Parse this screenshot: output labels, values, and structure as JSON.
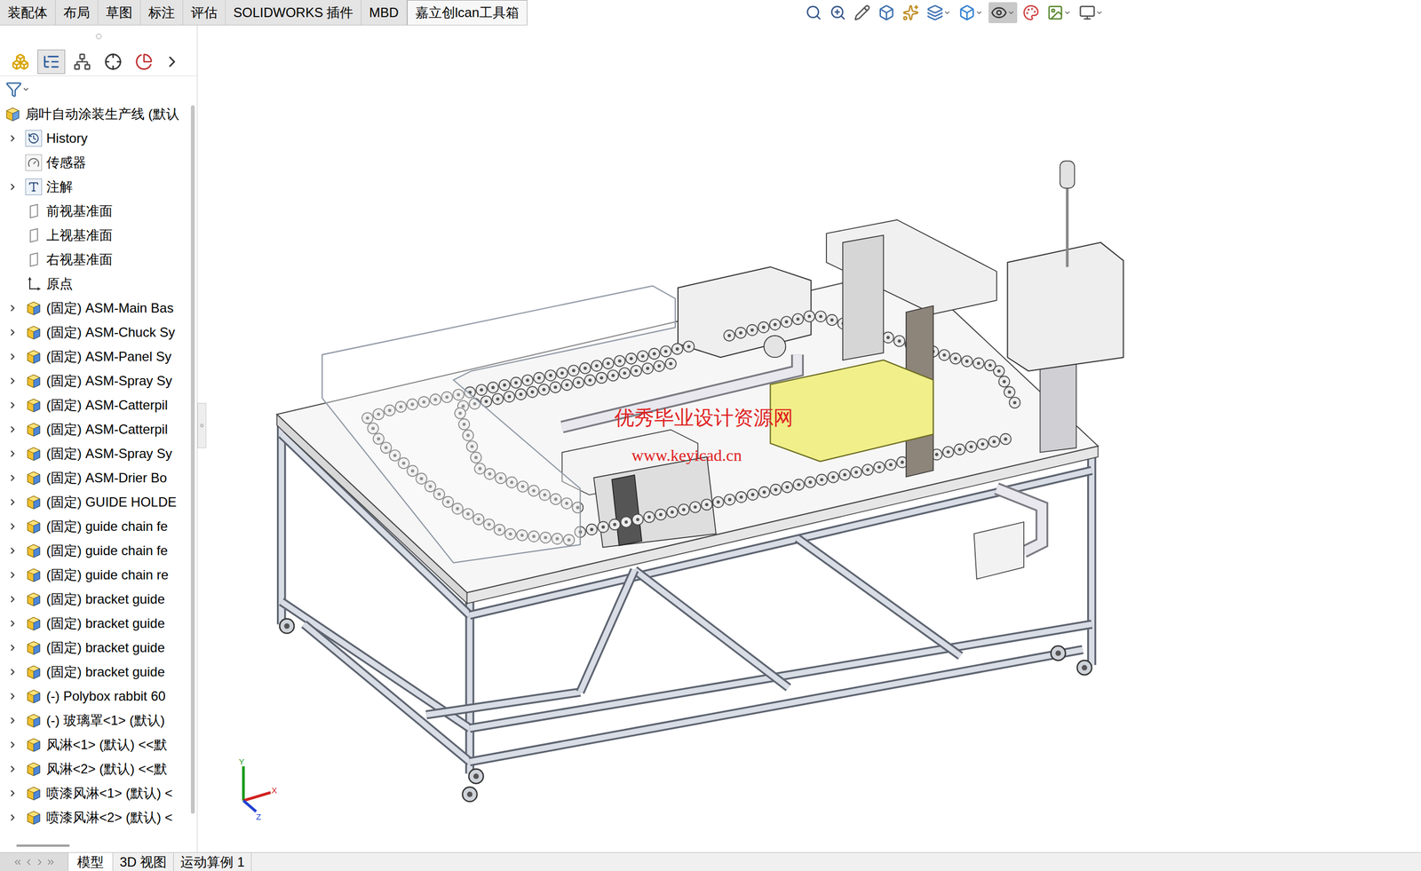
{
  "tabs": [
    {
      "label": "装配体",
      "selected": false
    },
    {
      "label": "布局",
      "selected": false
    },
    {
      "label": "草图",
      "selected": false
    },
    {
      "label": "标注",
      "selected": false
    },
    {
      "label": "评估",
      "selected": false
    },
    {
      "label": "SOLIDWORKS 插件",
      "selected": false
    },
    {
      "label": "MBD",
      "selected": false
    },
    {
      "label": "嘉立创lcan工具箱",
      "selected": true
    }
  ],
  "toolbar": [
    {
      "selected": false,
      "dropdown": false
    },
    {
      "selected": false,
      "dropdown": false
    },
    {
      "selected": false,
      "dropdown": false
    },
    {
      "selected": false,
      "dropdown": false
    },
    {
      "selected": false,
      "dropdown": false
    },
    {
      "selected": false,
      "dropdown": true
    },
    {
      "selected": false,
      "dropdown": true
    },
    {
      "selected": true,
      "dropdown": true
    },
    {
      "selected": false,
      "dropdown": false
    },
    {
      "selected": false,
      "dropdown": true
    },
    {
      "selected": false,
      "dropdown": true
    }
  ],
  "panel_tabs": [
    {
      "selected": false
    },
    {
      "selected": true
    },
    {
      "selected": false
    },
    {
      "selected": false
    },
    {
      "selected": false
    }
  ],
  "tree": [
    {
      "label": "扇叶自动涂装生产线 (默认",
      "kind": "root",
      "depth": 0,
      "expandable": false
    },
    {
      "label": "History",
      "kind": "history",
      "depth": 1,
      "expandable": true
    },
    {
      "label": "传感器",
      "kind": "sensor",
      "depth": 1,
      "expandable": false
    },
    {
      "label": "注解",
      "kind": "annotation",
      "depth": 1,
      "expandable": true
    },
    {
      "label": "前视基准面",
      "kind": "plane",
      "depth": 1,
      "expandable": false
    },
    {
      "label": "上视基准面",
      "kind": "plane",
      "depth": 1,
      "expandable": false
    },
    {
      "label": "右视基准面",
      "kind": "plane",
      "depth": 1,
      "expandable": false
    },
    {
      "label": "原点",
      "kind": "origin",
      "depth": 1,
      "expandable": false
    },
    {
      "label": "(固定) ASM-Main Bas",
      "kind": "assembly",
      "depth": 1,
      "expandable": true
    },
    {
      "label": "(固定) ASM-Chuck Sy",
      "kind": "assembly",
      "depth": 1,
      "expandable": true
    },
    {
      "label": "(固定) ASM-Panel Sy",
      "kind": "assembly",
      "depth": 1,
      "expandable": true
    },
    {
      "label": "(固定) ASM-Spray Sy",
      "kind": "assembly",
      "depth": 1,
      "expandable": true
    },
    {
      "label": "(固定) ASM-Catterpil",
      "kind": "assembly",
      "depth": 1,
      "expandable": true
    },
    {
      "label": "(固定) ASM-Catterpil",
      "kind": "assembly",
      "depth": 1,
      "expandable": true
    },
    {
      "label": "(固定) ASM-Spray Sy",
      "kind": "assembly",
      "depth": 1,
      "expandable": true
    },
    {
      "label": "(固定) ASM-Drier Bo",
      "kind": "assembly",
      "depth": 1,
      "expandable": true
    },
    {
      "label": "(固定) GUIDE HOLDE",
      "kind": "assembly",
      "depth": 1,
      "expandable": true
    },
    {
      "label": "(固定) guide chain fe",
      "kind": "assembly",
      "depth": 1,
      "expandable": true
    },
    {
      "label": "(固定) guide chain fe",
      "kind": "assembly",
      "depth": 1,
      "expandable": true
    },
    {
      "label": "(固定) guide chain re",
      "kind": "assembly",
      "depth": 1,
      "expandable": true
    },
    {
      "label": "(固定) bracket guide",
      "kind": "assembly",
      "depth": 1,
      "expandable": true
    },
    {
      "label": "(固定) bracket guide",
      "kind": "assembly",
      "depth": 1,
      "expandable": true
    },
    {
      "label": "(固定) bracket guide",
      "kind": "assembly",
      "depth": 1,
      "expandable": true
    },
    {
      "label": "(固定) bracket guide",
      "kind": "assembly",
      "depth": 1,
      "expandable": true
    },
    {
      "label": "(-) Polybox rabbit 60",
      "kind": "assembly",
      "depth": 1,
      "expandable": true
    },
    {
      "label": "(-) 玻璃罩<1> (默认)",
      "kind": "assembly",
      "depth": 1,
      "expandable": true
    },
    {
      "label": "风淋<1> (默认) <<默",
      "kind": "assembly",
      "depth": 1,
      "expandable": true
    },
    {
      "label": "风淋<2> (默认) <<默",
      "kind": "assembly",
      "depth": 1,
      "expandable": true
    },
    {
      "label": "喷漆风淋<1> (默认) <",
      "kind": "assembly",
      "depth": 1,
      "expandable": true
    },
    {
      "label": "喷漆风淋<2> (默认) <",
      "kind": "assembly",
      "depth": 1,
      "expandable": true
    }
  ],
  "watermark": [
    "优秀毕业设计资源网",
    "www.keyicad.cn"
  ],
  "axes": {
    "x": "X",
    "y": "Y",
    "z": "Z"
  },
  "bottom_tabs": [
    {
      "label": "模型",
      "selected": true
    },
    {
      "label": "3D 视图",
      "selected": false
    },
    {
      "label": "运动算例 1",
      "selected": false
    }
  ]
}
